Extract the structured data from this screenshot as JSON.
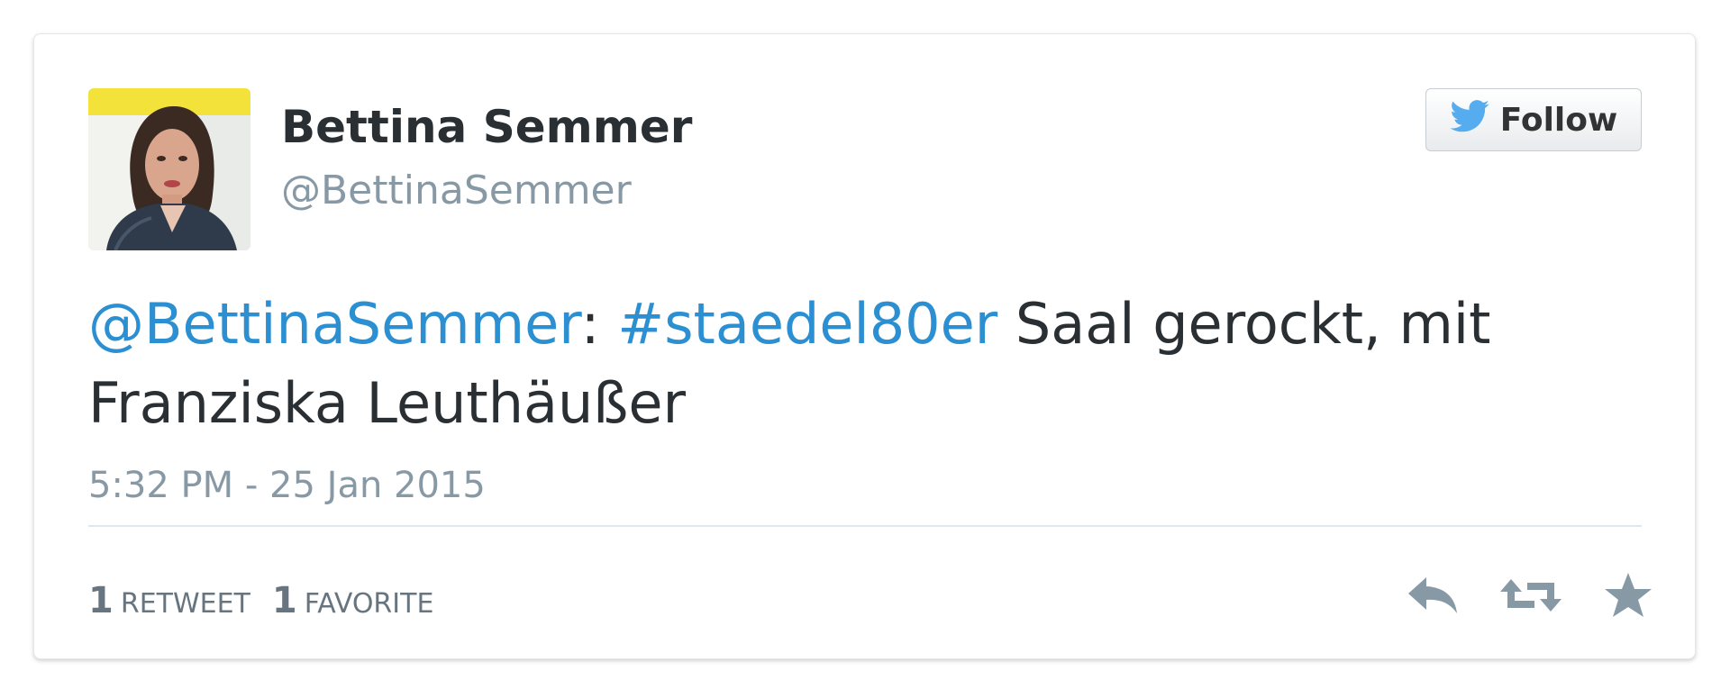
{
  "user": {
    "display_name": "Bettina Semmer",
    "handle": "@BettinaSemmer",
    "avatar_icon": "profile-photo"
  },
  "follow_button": {
    "label": "Follow",
    "icon": "twitter-bird-icon",
    "icon_color": "#55acee"
  },
  "tweet": {
    "mention": "@BettinaSemmer",
    "colon": ":",
    "hashtag": "#staedel80er",
    "text_line1_rest": " Saal gerockt, mit",
    "text_line2": "Franziska Leuthäußer",
    "timestamp": "5:32 PM - 25 Jan 2015",
    "link_color": "#2b8fd1"
  },
  "stats": {
    "retweet_count": "1",
    "retweet_label": "RETWEET",
    "favorite_count": "1",
    "favorite_label": "FAVORITE"
  },
  "actions": {
    "reply_icon": "reply-icon",
    "retweet_icon": "retweet-icon",
    "favorite_icon": "star-icon",
    "icon_color": "#8899a6"
  }
}
